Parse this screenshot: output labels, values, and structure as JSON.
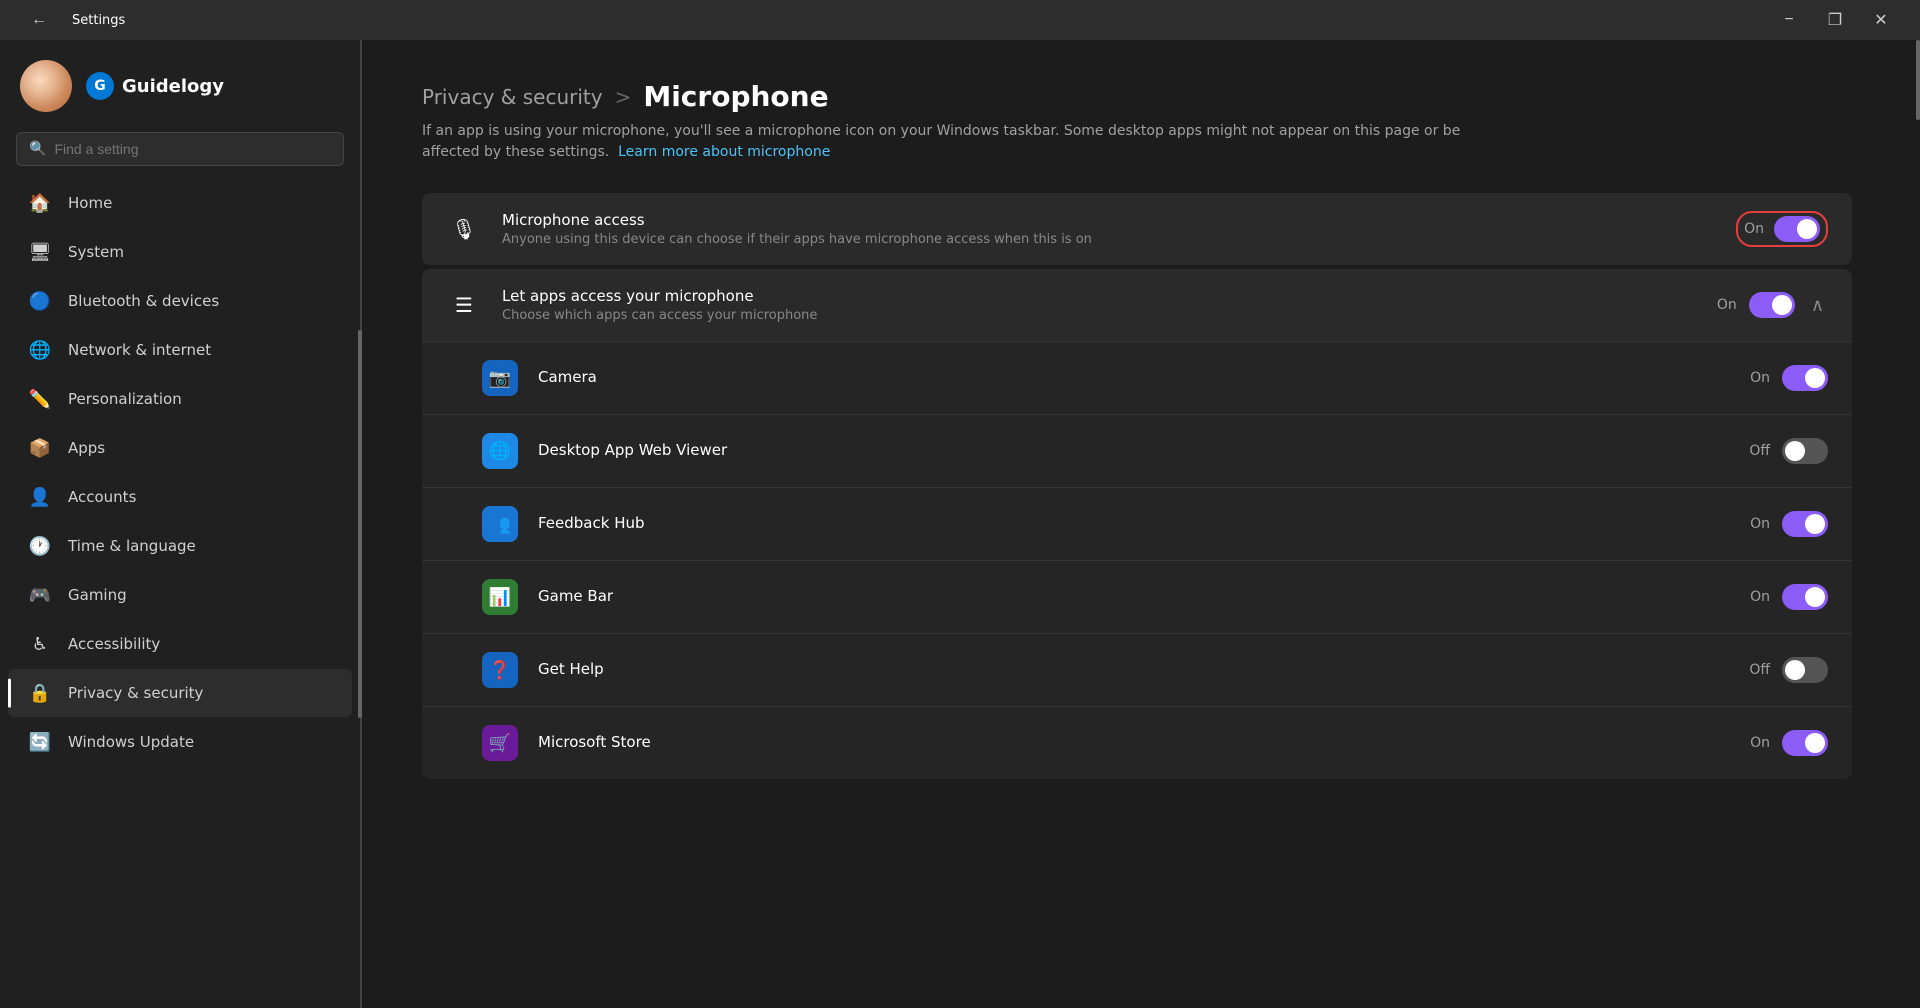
{
  "titlebar": {
    "title": "Settings",
    "minimize_label": "−",
    "restore_label": "❐",
    "close_label": "✕"
  },
  "sidebar": {
    "search_placeholder": "Find a setting",
    "brand_name": "Guidelogy",
    "nav_items": [
      {
        "id": "home",
        "label": "Home",
        "icon": "🏠"
      },
      {
        "id": "system",
        "label": "System",
        "icon": "🖥"
      },
      {
        "id": "bluetooth",
        "label": "Bluetooth & devices",
        "icon": "🔵"
      },
      {
        "id": "network",
        "label": "Network & internet",
        "icon": "🌐"
      },
      {
        "id": "personalization",
        "label": "Personalization",
        "icon": "✏️"
      },
      {
        "id": "apps",
        "label": "Apps",
        "icon": "📦"
      },
      {
        "id": "accounts",
        "label": "Accounts",
        "icon": "👤"
      },
      {
        "id": "time",
        "label": "Time & language",
        "icon": "🕐"
      },
      {
        "id": "gaming",
        "label": "Gaming",
        "icon": "🎮"
      },
      {
        "id": "accessibility",
        "label": "Accessibility",
        "icon": "♿"
      },
      {
        "id": "privacy",
        "label": "Privacy & security",
        "icon": "🔒",
        "active": true
      },
      {
        "id": "update",
        "label": "Windows Update",
        "icon": "🔄"
      }
    ]
  },
  "breadcrumb": {
    "parent": "Privacy & security",
    "separator": ">",
    "current": "Microphone"
  },
  "page_description": "If an app is using your microphone, you'll see a microphone icon on your Windows taskbar. Some desktop apps might not appear on this page or be affected by these settings.",
  "learn_more_text": "Learn more about microphone",
  "settings": {
    "microphone_access": {
      "title": "Microphone access",
      "subtitle": "Anyone using this device can choose if their apps have microphone access when this is on",
      "state": "On",
      "toggle_on": true,
      "highlighted": true
    },
    "let_apps_access": {
      "title": "Let apps access your microphone",
      "subtitle": "Choose which apps can access your microphone",
      "state": "On",
      "toggle_on": true,
      "expanded": true
    }
  },
  "apps": [
    {
      "id": "camera",
      "label": "Camera",
      "bg_color": "#1565c0",
      "icon": "📷",
      "state": "On",
      "toggle_on": true
    },
    {
      "id": "desktop_web_viewer",
      "label": "Desktop App Web Viewer",
      "bg_color": "#1e88e5",
      "icon": "🌐",
      "state": "Off",
      "toggle_on": false
    },
    {
      "id": "feedback_hub",
      "label": "Feedback Hub",
      "bg_color": "#1976d2",
      "icon": "👤",
      "state": "On",
      "toggle_on": true
    },
    {
      "id": "game_bar",
      "label": "Game Bar",
      "bg_color": "#2e7d32",
      "icon": "📊",
      "state": "On",
      "toggle_on": true
    },
    {
      "id": "get_help",
      "label": "Get Help",
      "bg_color": "#1565c0",
      "icon": "❓",
      "state": "Off",
      "toggle_on": false
    },
    {
      "id": "microsoft_store",
      "label": "Microsoft Store",
      "bg_color": "#6a1b9a",
      "icon": "🛒",
      "state": "On",
      "toggle_on": true
    }
  ]
}
